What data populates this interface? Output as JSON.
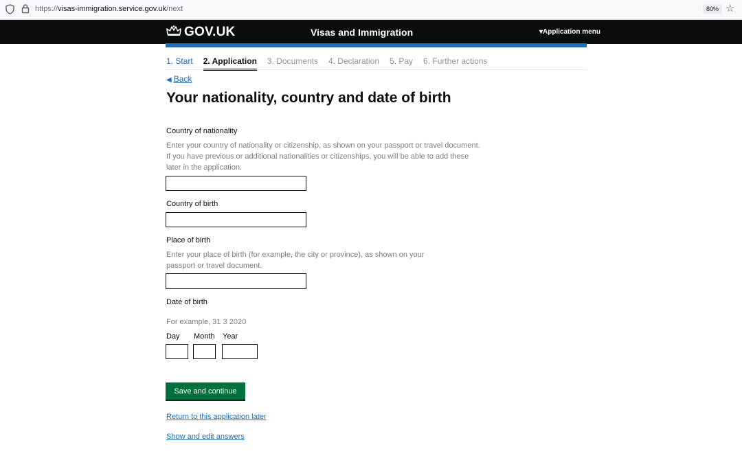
{
  "browser": {
    "url_prefix": "https://",
    "url_domain": "visas-immigration.service.gov.uk",
    "url_path": "/next",
    "zoom": "80%"
  },
  "header": {
    "logo_text": "GOV.UK",
    "service_name": "Visas and Immigration",
    "menu_label": "Application menu"
  },
  "steps": [
    {
      "label": "1. Start",
      "state": "done"
    },
    {
      "label": "2. Application",
      "state": "current"
    },
    {
      "label": "3. Documents",
      "state": "todo"
    },
    {
      "label": "4. Declaration",
      "state": "todo"
    },
    {
      "label": "5. Pay",
      "state": "todo"
    },
    {
      "label": "6. Further actions",
      "state": "todo"
    }
  ],
  "back_label": "Back",
  "page_title": "Your nationality, country and date of birth",
  "nationality": {
    "label": "Country of nationality",
    "hint": "Enter your country of nationality or citizenship, as shown on your passport or travel document. If you have previous or additional nationalities or citizenships, you will be able to add these later in the application.",
    "value": ""
  },
  "country_of_birth": {
    "label": "Country of birth",
    "value": ""
  },
  "place_of_birth": {
    "label": "Place of birth",
    "hint": "Enter your place of birth (for example, the city or province), as shown on your passport or travel document.",
    "value": ""
  },
  "date_of_birth": {
    "label": "Date of birth",
    "hint": "For example, 31 3 2020",
    "day_label": "Day",
    "month_label": "Month",
    "year_label": "Year",
    "day": "",
    "month": "",
    "year": ""
  },
  "actions": {
    "save_label": "Save and continue",
    "return_label": "Return to this application later",
    "show_edit_label": "Show and edit answers"
  },
  "colors": {
    "header_bg": "#0b0c0c",
    "brand_blue": "#1d70b8",
    "button_green": "#00703c"
  }
}
